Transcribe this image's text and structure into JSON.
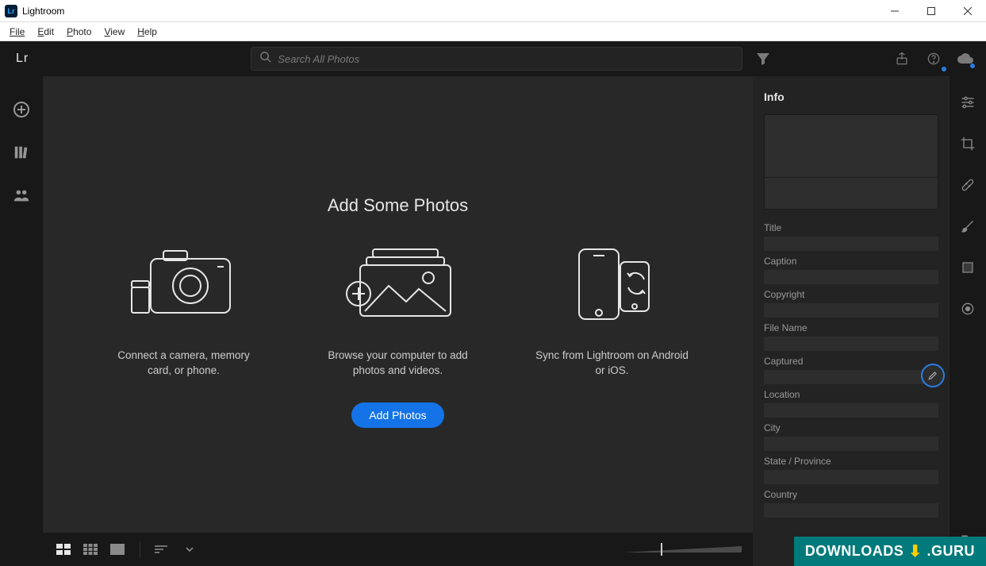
{
  "window": {
    "title": "Lightroom",
    "app_icon_text": "Lr"
  },
  "menu": {
    "items": [
      "File",
      "Edit",
      "Photo",
      "View",
      "Help"
    ]
  },
  "toolbar": {
    "logo": "Lr",
    "search_placeholder": "Search All Photos"
  },
  "empty_state": {
    "heading": "Add Some Photos",
    "cols": [
      {
        "desc": "Connect a camera, memory card, or phone."
      },
      {
        "desc": "Browse your computer to add photos and videos."
      },
      {
        "desc": "Sync from Lightroom on Android or iOS."
      }
    ],
    "add_button": "Add Photos"
  },
  "info_panel": {
    "title": "Info",
    "fields": [
      "Title",
      "Caption",
      "Copyright",
      "File Name",
      "Captured",
      "Location",
      "City",
      "State / Province",
      "Country"
    ]
  },
  "watermark": {
    "left": "DOWNLOADS",
    "right": ".GURU"
  }
}
